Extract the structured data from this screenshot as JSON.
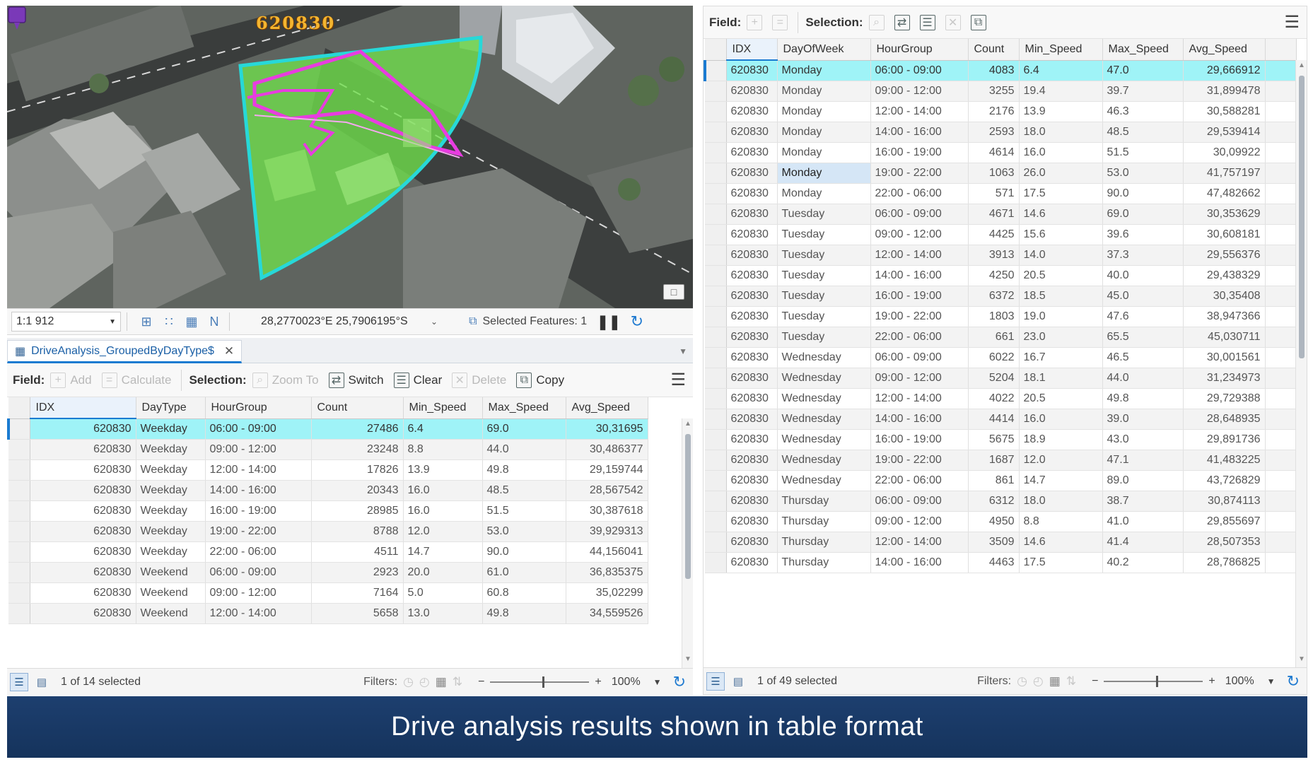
{
  "map": {
    "feature_label": "620830",
    "scale": "1:1 912",
    "coordinates": "28,2770023°E 25,7906195°S",
    "selected_features": "Selected Features: 1"
  },
  "left_table": {
    "tab_title": "DriveAnalysis_GroupedByDayType$",
    "toolbar": {
      "field_label": "Field:",
      "add": "Add",
      "calculate": "Calculate",
      "selection_label": "Selection:",
      "zoom_to": "Zoom To",
      "switch": "Switch",
      "clear": "Clear",
      "delete": "Delete",
      "copy": "Copy"
    },
    "columns": [
      "IDX",
      "DayType",
      "HourGroup",
      "Count",
      "Min_Speed",
      "Max_Speed",
      "Avg_Speed"
    ],
    "rows": [
      [
        "620830",
        "Weekday",
        "06:00 - 09:00",
        "27486",
        "6.4",
        "69.0",
        "30,31695"
      ],
      [
        "620830",
        "Weekday",
        "09:00 - 12:00",
        "23248",
        "8.8",
        "44.0",
        "30,486377"
      ],
      [
        "620830",
        "Weekday",
        "12:00 - 14:00",
        "17826",
        "13.9",
        "49.8",
        "29,159744"
      ],
      [
        "620830",
        "Weekday",
        "14:00 - 16:00",
        "20343",
        "16.0",
        "48.5",
        "28,567542"
      ],
      [
        "620830",
        "Weekday",
        "16:00 - 19:00",
        "28985",
        "16.0",
        "51.5",
        "30,387618"
      ],
      [
        "620830",
        "Weekday",
        "19:00 - 22:00",
        "8788",
        "12.0",
        "53.0",
        "39,929313"
      ],
      [
        "620830",
        "Weekday",
        "22:00 - 06:00",
        "4511",
        "14.7",
        "90.0",
        "44,156041"
      ],
      [
        "620830",
        "Weekend",
        "06:00 - 09:00",
        "2923",
        "20.0",
        "61.0",
        "36,835375"
      ],
      [
        "620830",
        "Weekend",
        "09:00 - 12:00",
        "7164",
        "5.0",
        "60.8",
        "35,02299"
      ],
      [
        "620830",
        "Weekend",
        "12:00 - 14:00",
        "5658",
        "13.0",
        "49.8",
        "34,559526"
      ]
    ],
    "footer": {
      "selected": "1 of 14 selected",
      "filters": "Filters:",
      "zoom": "100%"
    }
  },
  "right_table": {
    "toolbar": {
      "field_label": "Field:",
      "selection_label": "Selection:"
    },
    "columns": [
      "IDX",
      "DayOfWeek",
      "HourGroup",
      "Count",
      "Min_Speed",
      "Max_Speed",
      "Avg_Speed"
    ],
    "rows": [
      [
        "620830",
        "Monday",
        "06:00 - 09:00",
        "4083",
        "6.4",
        "47.0",
        "29,666912"
      ],
      [
        "620830",
        "Monday",
        "09:00 - 12:00",
        "3255",
        "19.4",
        "39.7",
        "31,899478"
      ],
      [
        "620830",
        "Monday",
        "12:00 - 14:00",
        "2176",
        "13.9",
        "46.3",
        "30,588281"
      ],
      [
        "620830",
        "Monday",
        "14:00 - 16:00",
        "2593",
        "18.0",
        "48.5",
        "29,539414"
      ],
      [
        "620830",
        "Monday",
        "16:00 - 19:00",
        "4614",
        "16.0",
        "51.5",
        "30,09922"
      ],
      [
        "620830",
        "Monday",
        "19:00 - 22:00",
        "1063",
        "26.0",
        "53.0",
        "41,757197"
      ],
      [
        "620830",
        "Monday",
        "22:00 - 06:00",
        "571",
        "17.5",
        "90.0",
        "47,482662"
      ],
      [
        "620830",
        "Tuesday",
        "06:00 - 09:00",
        "4671",
        "14.6",
        "69.0",
        "30,353629"
      ],
      [
        "620830",
        "Tuesday",
        "09:00 - 12:00",
        "4425",
        "15.6",
        "39.6",
        "30,608181"
      ],
      [
        "620830",
        "Tuesday",
        "12:00 - 14:00",
        "3913",
        "14.0",
        "37.3",
        "29,556376"
      ],
      [
        "620830",
        "Tuesday",
        "14:00 - 16:00",
        "4250",
        "20.5",
        "40.0",
        "29,438329"
      ],
      [
        "620830",
        "Tuesday",
        "16:00 - 19:00",
        "6372",
        "18.5",
        "45.0",
        "30,35408"
      ],
      [
        "620830",
        "Tuesday",
        "19:00 - 22:00",
        "1803",
        "19.0",
        "47.6",
        "38,947366"
      ],
      [
        "620830",
        "Tuesday",
        "22:00 - 06:00",
        "661",
        "23.0",
        "65.5",
        "45,030711"
      ],
      [
        "620830",
        "Wednesday",
        "06:00 - 09:00",
        "6022",
        "16.7",
        "46.5",
        "30,001561"
      ],
      [
        "620830",
        "Wednesday",
        "09:00 - 12:00",
        "5204",
        "18.1",
        "44.0",
        "31,234973"
      ],
      [
        "620830",
        "Wednesday",
        "12:00 - 14:00",
        "4022",
        "20.5",
        "49.8",
        "29,729388"
      ],
      [
        "620830",
        "Wednesday",
        "14:00 - 16:00",
        "4414",
        "16.0",
        "39.0",
        "28,648935"
      ],
      [
        "620830",
        "Wednesday",
        "16:00 - 19:00",
        "5675",
        "18.9",
        "43.0",
        "29,891736"
      ],
      [
        "620830",
        "Wednesday",
        "19:00 - 22:00",
        "1687",
        "12.0",
        "47.1",
        "41,483225"
      ],
      [
        "620830",
        "Wednesday",
        "22:00 - 06:00",
        "861",
        "14.7",
        "89.0",
        "43,726829"
      ],
      [
        "620830",
        "Thursday",
        "06:00 - 09:00",
        "6312",
        "18.0",
        "38.7",
        "30,874113"
      ],
      [
        "620830",
        "Thursday",
        "09:00 - 12:00",
        "4950",
        "8.8",
        "41.0",
        "29,855697"
      ],
      [
        "620830",
        "Thursday",
        "12:00 - 14:00",
        "3509",
        "14.6",
        "41.4",
        "28,507353"
      ],
      [
        "620830",
        "Thursday",
        "14:00 - 16:00",
        "4463",
        "17.5",
        "40.2",
        "28,786825"
      ]
    ],
    "footer": {
      "selected": "1 of 49 selected",
      "filters": "Filters:",
      "zoom": "100%"
    }
  },
  "banner": {
    "text": "Drive analysis results shown in table format"
  },
  "colors": {
    "selected_row": "#9ff3f7",
    "polygon_fill": "#6fe04b",
    "polygon_outline": "#27d8d8",
    "road_outline": "#e83ce0",
    "banner_bg": "#1d3f6f",
    "accent": "#1a7bd1"
  }
}
